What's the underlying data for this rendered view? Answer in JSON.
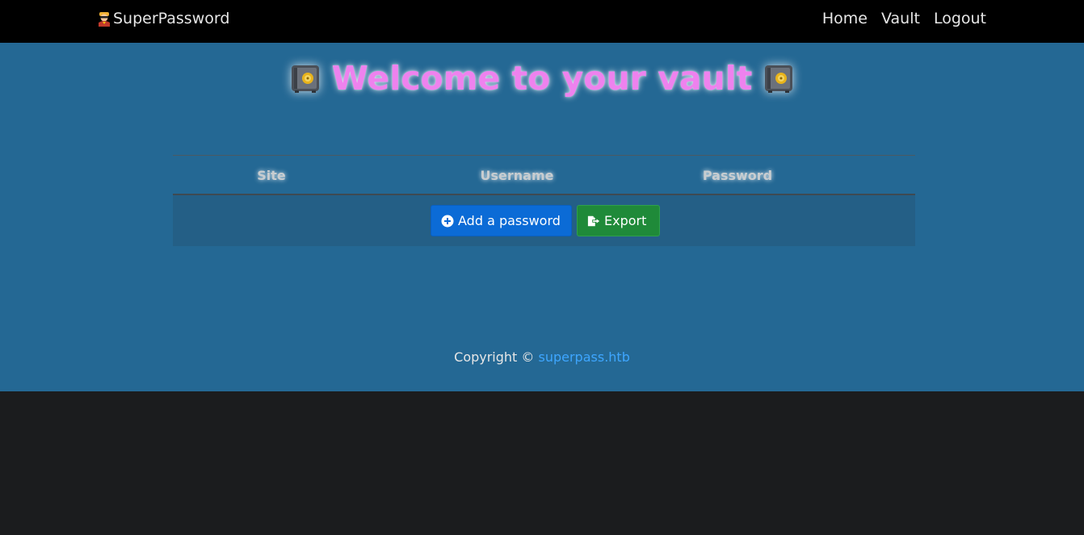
{
  "navbar": {
    "brand_icon": "superhero-emoji-icon",
    "brand": "SuperPassword",
    "links": [
      "Home",
      "Vault",
      "Logout"
    ]
  },
  "header": {
    "icon": "safe-emoji-icon",
    "title": "Welcome to your vault"
  },
  "table": {
    "columns": [
      "Site",
      "Username",
      "Password"
    ],
    "rows": []
  },
  "actions": {
    "add_label": "Add a password",
    "add_icon": "plus-circle-icon",
    "export_label": "Export",
    "export_icon": "file-export-icon"
  },
  "footer": {
    "prefix": "Copyright ©",
    "link": "superpass.htb"
  },
  "colors": {
    "navbar": "#000000",
    "main_bg": "#246894",
    "title": "#ee82ee",
    "add_button": "#0b6bd6",
    "export_button": "#1f8a39",
    "link": "#3ea6ff",
    "page_bg": "#1b1c1e"
  }
}
